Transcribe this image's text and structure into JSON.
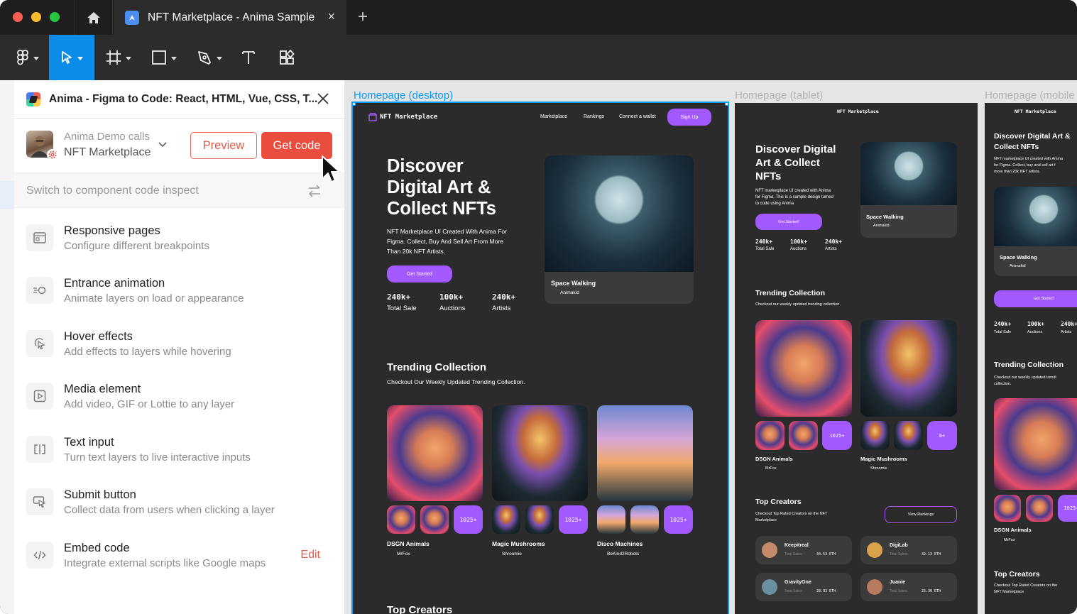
{
  "window": {
    "traffic_colors": [
      "#ff5f57",
      "#febc2e",
      "#28c840"
    ]
  },
  "tab": {
    "title": "NFT Marketplace - Anima Sample",
    "close": "×",
    "new": "+"
  },
  "panel": {
    "title": "Anima - Figma to Code: React, HTML, Vue, CSS, T...",
    "project_team": "Anima Demo calls",
    "project_name": "NFT Marketplace",
    "preview_label": "Preview",
    "get_code_label": "Get code",
    "switch_label": "Switch to component code inspect",
    "features": [
      {
        "title": "Responsive pages",
        "sub": "Configure different breakpoints",
        "icon": "responsive-icon"
      },
      {
        "title": "Entrance animation",
        "sub": "Animate layers on load or appearance",
        "icon": "animation-icon"
      },
      {
        "title": "Hover effects",
        "sub": "Add effects to layers while hovering",
        "icon": "hover-icon"
      },
      {
        "title": "Media element",
        "sub": "Add video, GIF or Lottie to any layer",
        "icon": "media-icon"
      },
      {
        "title": "Text input",
        "sub": "Turn text layers to live interactive inputs",
        "icon": "text-input-icon"
      },
      {
        "title": "Submit button",
        "sub": "Collect data from users when clicking a layer",
        "icon": "submit-icon"
      },
      {
        "title": "Embed code",
        "sub": "Integrate external scripts like Google maps",
        "icon": "embed-icon"
      }
    ],
    "edit_label": "Edit"
  },
  "canvas": {
    "frame_labels": [
      "Homepage (desktop)",
      "Homepage (tablet)",
      "Homepage (mobile"
    ],
    "site": {
      "brand": "NFT Marketplace",
      "nav": [
        "Marketplace",
        "Rankings",
        "Connect a wallet"
      ],
      "signup": "Sign Up",
      "hero_title": "Discover Digital Art & Collect NFTs",
      "hero_title_lines": [
        "Discover",
        "Digital Art &",
        "Collect NFTs"
      ],
      "hero_title_tablet": [
        "Discover Digital",
        "Art & Collect",
        "NFTs"
      ],
      "hero_title_mobile": [
        "Discover Digital Art &",
        "Collect NFTs"
      ],
      "hero_sub": "NFT Marketplace UI Created With Anima For Figma. Collect, Buy And Sell Art From More Than 20k NFT Artists.",
      "hero_sub_lines": [
        "NFT Marketplace UI Created With Anima For",
        "Figma. Collect, Buy And Sell Art From More",
        "Than 20k NFT Artists."
      ],
      "hero_sub_tablet": [
        "NFT marketplace UI created with Anima",
        "for Figma. This is a sample design turned",
        "to code using Anima"
      ],
      "hero_sub_mobile": [
        "NFT marketplace UI created with Anima",
        "for Figma. Collect, buy and sell art f",
        "more than 20k NFT artists."
      ],
      "get_started": "Get Started",
      "get_started_tablet": "Get Started!",
      "stats": [
        {
          "value": "240k+",
          "label": "Total Sale"
        },
        {
          "value": "100k+",
          "label": "Auctions"
        },
        {
          "value": "240k+",
          "label": "Artists"
        }
      ],
      "featured_title": "Space Walking",
      "featured_artist": "Animakid",
      "trending_title": "Trending Collection",
      "trending_sub": "Checkout Our Weekly Updated Trending Collection.",
      "trending_sub_tablet": "Checkout our weekly updated trending collection.",
      "trending_sub_mobile": [
        "Checkout our weekly updated trendi",
        "collection."
      ],
      "collections": [
        {
          "name": "DSGN Animals",
          "artist": "MrFox",
          "count": "1025+"
        },
        {
          "name": "Magic Mushrooms",
          "artist": "Shroomie",
          "count": "1025+"
        },
        {
          "name": "Disco Machines",
          "artist": "BeKind2Robots",
          "count": "1025+"
        }
      ],
      "tablet_mushroom_count": "6+",
      "top_creators": "Top Creators",
      "top_creators_sub": [
        "Checkout Top Rated Creators on the NFT",
        "Marketplace"
      ],
      "top_creators_sub_mobile": [
        "Checkout Top Rated Creators on the",
        "NFT Marketplace"
      ],
      "view_rankings": "View Rankings",
      "creators": [
        {
          "name": "Keepitreal",
          "sales_label": "Total Sales:",
          "sales": "34.53 ETH"
        },
        {
          "name": "DigiLab",
          "sales_label": "Total Sales:",
          "sales": "32.13 ETH"
        },
        {
          "name": "GravityOne",
          "sales_label": "Total Sales:",
          "sales": "28.93 ETH"
        },
        {
          "name": "Juanie",
          "sales_label": "Total Sales:",
          "sales": "25.30 ETH"
        }
      ]
    }
  }
}
